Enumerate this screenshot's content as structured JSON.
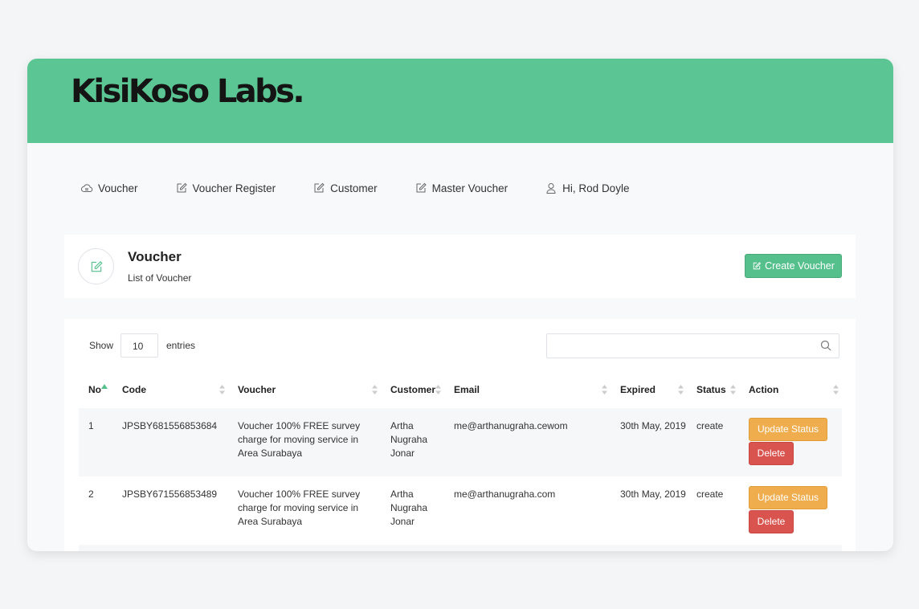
{
  "header": {
    "logo": "KisiKoso Labs."
  },
  "nav": {
    "items": [
      {
        "label": "Voucher"
      },
      {
        "label": "Voucher Register"
      },
      {
        "label": "Customer"
      },
      {
        "label": "Master Voucher"
      },
      {
        "label": "Hi, Rod Doyle"
      }
    ]
  },
  "page": {
    "title": "Voucher",
    "subtitle": "List of Voucher",
    "create_label": "Create Voucher"
  },
  "controls": {
    "show_label": "Show",
    "page_length": "10",
    "entries_label": "entries",
    "search_value": ""
  },
  "table": {
    "columns": [
      "No",
      "Code",
      "Voucher",
      "Customer",
      "Email",
      "Expired",
      "Status",
      "Action"
    ],
    "rows": [
      {
        "no": "1",
        "code": "JPSBY681556853684",
        "voucher": "Voucher 100% FREE survey charge for moving service in Area Surabaya",
        "customer": "Artha Nugraha Jonar",
        "email": "me@arthanugraha.cewom",
        "expired": "30th May, 2019",
        "status": "create",
        "update_label": "Update Status",
        "delete_label": "Delete"
      },
      {
        "no": "2",
        "code": "JPSBY671556853489",
        "voucher": "Voucher 100% FREE survey charge for moving service in Area Surabaya",
        "customer": "Artha Nugraha Jonar",
        "email": "me@arthanugraha.com",
        "expired": "30th May, 2019",
        "status": "create",
        "update_label": "Update Status",
        "delete_label": "Delete"
      }
    ]
  },
  "colors": {
    "header_green": "#5bc594",
    "button_green": "#56c08d",
    "warning": "#f0ad4e",
    "danger": "#d9534f"
  },
  "icons": {
    "nav": [
      "cloud-icon",
      "edit-icon",
      "edit-icon",
      "edit-icon",
      "user-icon"
    ],
    "page": "edit-icon",
    "search": "search-icon"
  }
}
